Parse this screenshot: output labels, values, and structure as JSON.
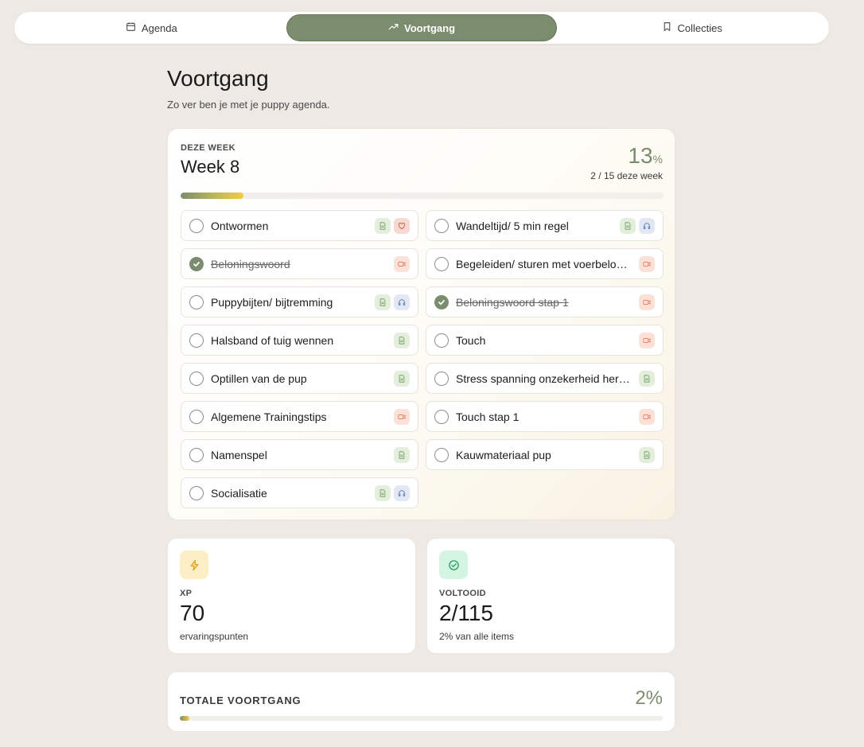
{
  "tabs": [
    {
      "label": "Agenda",
      "icon": "calendar-icon",
      "active": false
    },
    {
      "label": "Voortgang",
      "icon": "trending-up-icon",
      "active": true
    },
    {
      "label": "Collecties",
      "icon": "bookmark-icon",
      "active": false
    }
  ],
  "header": {
    "title": "Voortgang",
    "subtitle": "Zo ver ben je met je puppy agenda."
  },
  "week": {
    "eyebrow": "DEZE WEEK",
    "title": "Week 8",
    "percent": "13",
    "percent_sign": "%",
    "progress_fraction": 0.13,
    "count_text": "2 / 15 deze week",
    "tasks": [
      {
        "label": "Ontwormen",
        "done": false,
        "badges": [
          "doc",
          "heart"
        ]
      },
      {
        "label": "Wandeltijd/ 5 min regel",
        "done": false,
        "badges": [
          "doc",
          "audio"
        ]
      },
      {
        "label": "Beloningswoord",
        "done": true,
        "badges": [
          "video"
        ]
      },
      {
        "label": "Begeleiden/ sturen met voerbeloning",
        "done": false,
        "badges": [
          "video"
        ]
      },
      {
        "label": "Puppybijten/ bijtremming",
        "done": false,
        "badges": [
          "doc",
          "audio"
        ]
      },
      {
        "label": "Beloningswoord stap 1",
        "done": true,
        "badges": [
          "video"
        ]
      },
      {
        "label": "Halsband of tuig wennen",
        "done": false,
        "badges": [
          "doc"
        ]
      },
      {
        "label": "Touch",
        "done": false,
        "badges": [
          "video"
        ]
      },
      {
        "label": "Optillen van de pup",
        "done": false,
        "badges": [
          "doc"
        ]
      },
      {
        "label": "Stress spanning onzekerheid herkennen",
        "done": false,
        "badges": [
          "doc"
        ]
      },
      {
        "label": "Algemene Trainingstips",
        "done": false,
        "badges": [
          "video"
        ]
      },
      {
        "label": "Touch stap 1",
        "done": false,
        "badges": [
          "video"
        ]
      },
      {
        "label": "Namenspel",
        "done": false,
        "badges": [
          "doc"
        ]
      },
      {
        "label": "Kauwmateriaal pup",
        "done": false,
        "badges": [
          "doc"
        ]
      },
      {
        "label": "Socialisatie",
        "done": false,
        "badges": [
          "doc",
          "audio"
        ]
      }
    ]
  },
  "stats": {
    "xp": {
      "label": "XP",
      "value": "70",
      "sub": "ervaringspunten",
      "icon": "lightning-icon",
      "icon_bg": "#FDEFC5",
      "icon_color": "#E0A21E"
    },
    "done": {
      "label": "VOLTOOID",
      "value": "2/115",
      "sub": "2% van alle items",
      "icon": "check-circle-icon",
      "icon_bg": "#D5F5E3",
      "icon_color": "#2E9E63"
    }
  },
  "total": {
    "label": "TOTALE VOORTGANG",
    "percent_text": "2%",
    "progress_fraction": 0.02
  },
  "colors": {
    "accent": "#7C8C6E",
    "background": "#EEE9E4"
  }
}
